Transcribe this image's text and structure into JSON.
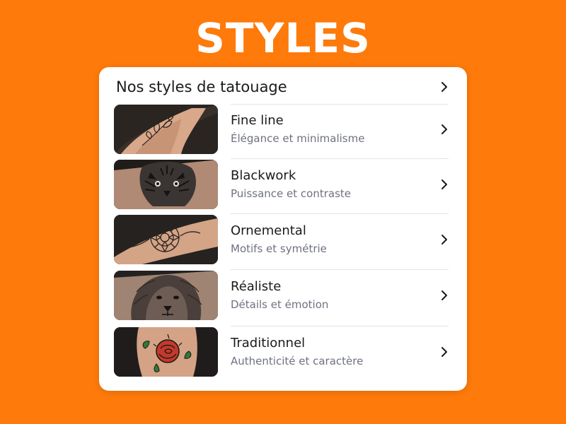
{
  "page": {
    "title": "STYLES"
  },
  "card": {
    "header": "Nos styles de tatouage",
    "items": [
      {
        "title": "Fine line",
        "subtitle": "Élégance et minimalisme",
        "image": "fine-line-floral-tattoo"
      },
      {
        "title": "Blackwork",
        "subtitle": "Puissance et contraste",
        "image": "blackwork-tiger-tattoo"
      },
      {
        "title": "Ornemental",
        "subtitle": "Motifs et symétrie",
        "image": "ornamental-mandala-tattoo"
      },
      {
        "title": "Réaliste",
        "subtitle": "Détails et émotion",
        "image": "realistic-lion-tattoo"
      },
      {
        "title": "Traditionnel",
        "subtitle": "Authenticité et caractère",
        "image": "traditional-rose-tattoo"
      }
    ]
  },
  "colors": {
    "background": "#fe7a0b",
    "card": "#ffffff",
    "text": "#1b1b1f",
    "subtext": "#6e7280",
    "chevron": "#1b1b1f"
  },
  "icons": {
    "chevron": "chevron-right-icon"
  }
}
